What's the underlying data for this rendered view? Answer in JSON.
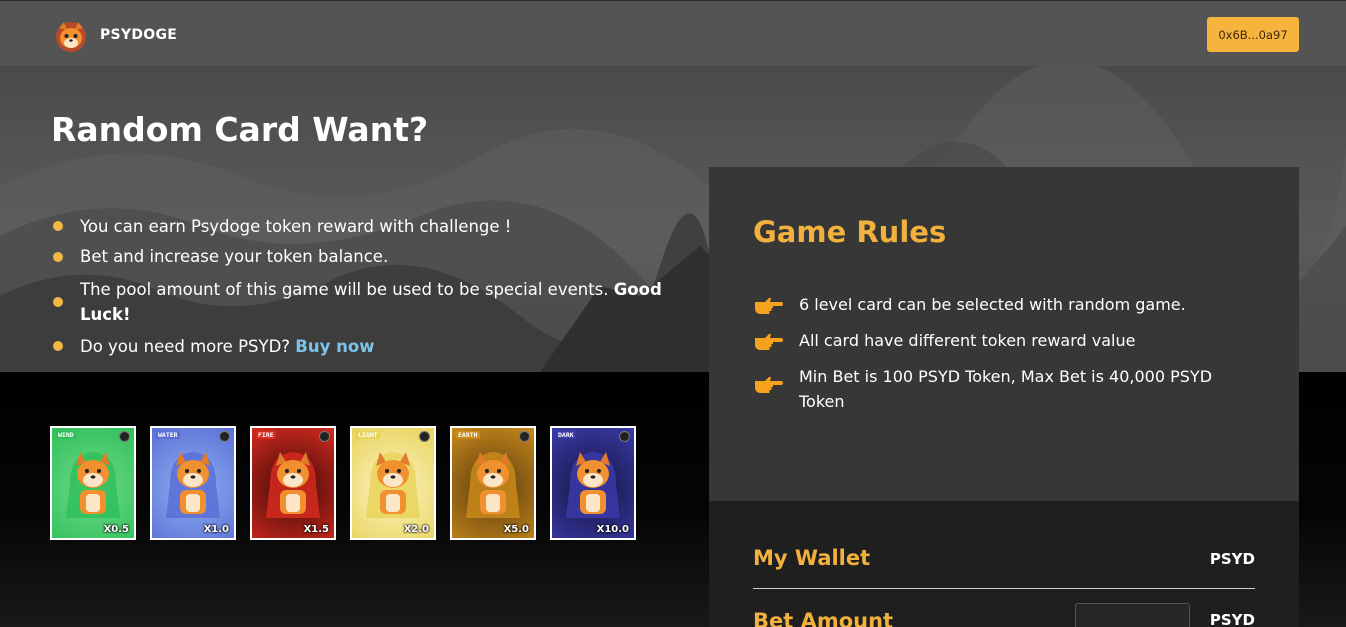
{
  "header": {
    "brand": "PSYDOGE",
    "wallet_address": "0x6B...0a97",
    "logo_icon": "shiba-doge-logo-icon"
  },
  "hero": {
    "headline": "Random Card Want?",
    "features": [
      "You can earn Psydoge token reward with challenge !",
      "Bet and increase your token balance.",
      "The pool amount of this game will be used to be special events."
    ],
    "features_bold_tail": "Good Luck!",
    "more_prefix": "Do you need more PSYD?",
    "buy_link": "Buy now",
    "bullet_color": "#f2b844"
  },
  "cards": [
    {
      "element": "WIND",
      "multiplier": "X0.5",
      "color": "#2fbf5a",
      "bg": "#6fd98a"
    },
    {
      "element": "WATER",
      "multiplier": "X1.0",
      "color": "#5a6fd6",
      "bg": "#8eb0f0"
    },
    {
      "element": "FIRE",
      "multiplier": "X1.5",
      "color": "#d62a1e",
      "bg": "#3a0a08"
    },
    {
      "element": "LIGHT",
      "multiplier": "X2.0",
      "color": "#e8d35a",
      "bg": "#fbf3c2"
    },
    {
      "element": "EARTH",
      "multiplier": "X5.0",
      "color": "#c98a1a",
      "bg": "#5a3a10"
    },
    {
      "element": "DARK",
      "multiplier": "X10.0",
      "color": "#3a3aa8",
      "bg": "#151540"
    }
  ],
  "rules": {
    "title": "Game Rules",
    "items": [
      "6 level card can be selected with random game.",
      "All card have different token reward value",
      "Min Bet is 100 PSYD Token, Max Bet is 40,000 PSYD Token"
    ],
    "accent_color": "#f2b13d",
    "item_icon": "pointing-hand-icon"
  },
  "bet": {
    "wallet_label": "My Wallet",
    "wallet_unit": "PSYD",
    "amount_label": "Bet Amount",
    "amount_unit": "PSYD",
    "amount_value": ""
  }
}
